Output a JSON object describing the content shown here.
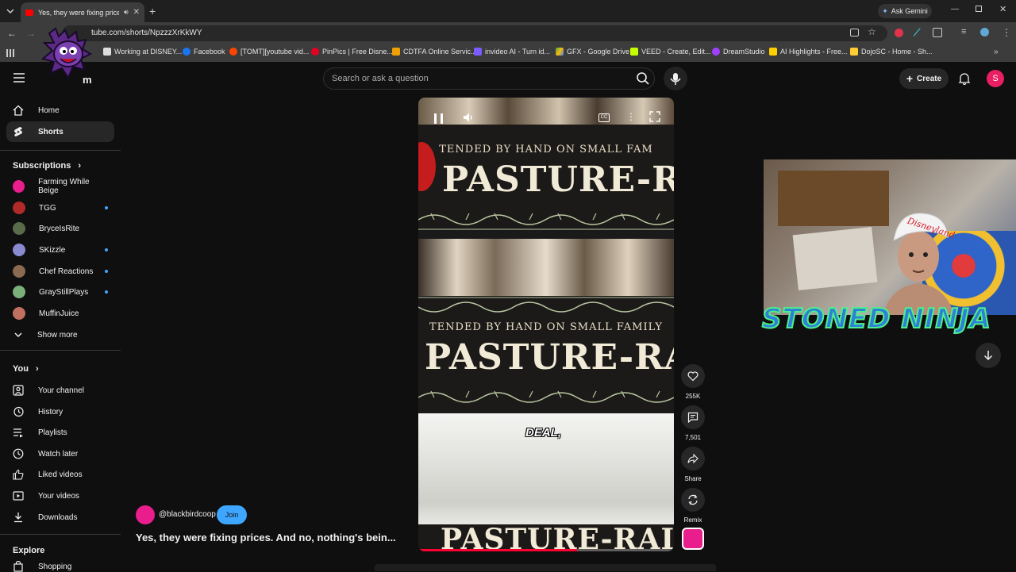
{
  "browser": {
    "tab_title": "Yes, they were fixing prices",
    "url": "tube.com/shorts/NpzzzXrKkWY",
    "ask_gemini": "Ask Gemini",
    "bookmarks": [
      {
        "label": "Working at DISNEY...",
        "color": "#ffffff"
      },
      {
        "label": "Facebook",
        "color": "#1877f2"
      },
      {
        "label": "[TOMT][youtube vid...",
        "color": "#ff4500"
      },
      {
        "label": "PinPics | Free Disne...",
        "color": "#e60023"
      },
      {
        "label": "CDTFA Online Servic...",
        "color": "#f0a000"
      },
      {
        "label": "invideo AI - Turn id...",
        "color": "#7b5cff"
      },
      {
        "label": "GFX - Google Drive",
        "color": "#34a853"
      },
      {
        "label": "VEED - Create, Edit...",
        "color": "#c8ff00"
      },
      {
        "label": "DreamStudio",
        "color": "#a040ff"
      },
      {
        "label": "AI Highlights - Free...",
        "color": "#ffd000"
      },
      {
        "label": "DojoSC - Home - Sh...",
        "color": "#ffcc33"
      }
    ]
  },
  "header": {
    "logo_fragment": "m",
    "search_placeholder": "Search or ask a question",
    "create_label": "Create",
    "avatar_letter": "S",
    "avatar_color": "#e91e63"
  },
  "sidebar": {
    "main": [
      {
        "label": "Home",
        "icon": "home-icon"
      },
      {
        "label": "Shorts",
        "icon": "shorts-icon",
        "active": true
      }
    ],
    "subscriptions_heading": "Subscriptions",
    "subscriptions": [
      {
        "name": "Farming While Beige",
        "color": "#e91e8c",
        "new": false
      },
      {
        "name": "TGG",
        "color": "#b02a2a",
        "new": true
      },
      {
        "name": "BryceIsRite",
        "color": "#5a6b4a",
        "new": false
      },
      {
        "name": "SKizzle",
        "color": "#8a8ad0",
        "new": true
      },
      {
        "name": "Chef Reactions",
        "color": "#8a6a50",
        "new": true
      },
      {
        "name": "GrayStillPlays",
        "color": "#7ab07a",
        "new": true
      },
      {
        "name": "MuffinJuice",
        "color": "#c07060",
        "new": false
      }
    ],
    "show_more": "Show more",
    "you_heading": "You",
    "you": [
      {
        "label": "Your channel",
        "icon": "channel-icon"
      },
      {
        "label": "History",
        "icon": "history-icon"
      },
      {
        "label": "Playlists",
        "icon": "playlists-icon"
      },
      {
        "label": "Watch later",
        "icon": "watch-later-icon"
      },
      {
        "label": "Liked videos",
        "icon": "like-icon"
      },
      {
        "label": "Your videos",
        "icon": "your-videos-icon"
      },
      {
        "label": "Downloads",
        "icon": "download-icon"
      }
    ],
    "explore_heading": "Explore",
    "explore_first": "Shopping"
  },
  "short": {
    "overlay_lines": {
      "tended": "TENDED BY HAND ON SMALL FAM",
      "tended2": "TENDED BY HAND ON SMALL FAMILY",
      "pasture": "PASTURE-RA",
      "pasture2": "PASTURE-RAIS",
      "pasture3": "PASTURE-RAI"
    },
    "caption": "DEAL,",
    "channel": "@blackbirdcoop",
    "join_label": "Join",
    "title": "Yes, they were fixing prices. And no, nothing's bein...",
    "actions": {
      "likes": "255K",
      "comments": "7,501",
      "share": "Share",
      "remix": "Remix"
    }
  },
  "webcam": {
    "streamer_name": "STONED NINJA",
    "hat_text": "Disneyland"
  }
}
